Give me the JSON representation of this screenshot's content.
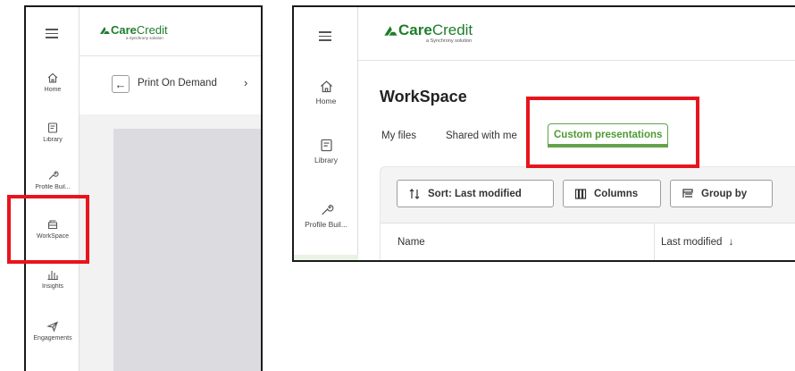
{
  "brand": {
    "name_bold": "Care",
    "name_regular": "Credit",
    "tagline": "a Synchrony solution"
  },
  "left_screen": {
    "nav": [
      {
        "label": "Home",
        "icon": "home-icon"
      },
      {
        "label": "Library",
        "icon": "library-icon"
      },
      {
        "label": "Profile Buil...",
        "icon": "wrench-icon"
      },
      {
        "label": "WorkSpace",
        "icon": "workspace-icon"
      },
      {
        "label": "Insights",
        "icon": "insights-icon"
      },
      {
        "label": "Engagements",
        "icon": "send-icon"
      }
    ],
    "breadcrumb": "Print On Demand"
  },
  "right_screen": {
    "nav": [
      {
        "label": "Home",
        "icon": "home-icon"
      },
      {
        "label": "Library",
        "icon": "library-icon"
      },
      {
        "label": "Profile Buil...",
        "icon": "wrench-icon"
      }
    ],
    "title": "WorkSpace",
    "tabs": [
      {
        "label": "My files"
      },
      {
        "label": "Shared with me"
      },
      {
        "label": "Custom presentations",
        "active": true
      }
    ],
    "toolbar": {
      "sort_label": "Sort: Last modified",
      "columns_label": "Columns",
      "group_label": "Group by"
    },
    "table_headers": {
      "name": "Name",
      "last_modified": "Last modified",
      "sort_arrow": "↓"
    }
  },
  "colors": {
    "brand_green": "#1f7d2d",
    "active_tab": "#63a34b",
    "highlight": "#e8141d"
  }
}
